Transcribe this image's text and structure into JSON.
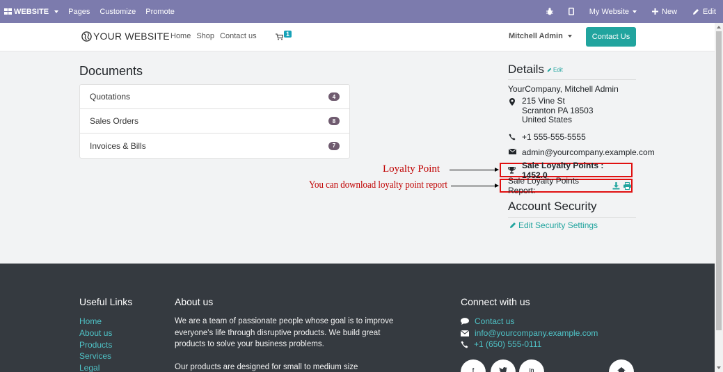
{
  "odoo_bar": {
    "apps_label": "WEBSITE",
    "menu": [
      "Pages",
      "Customize",
      "Promote"
    ],
    "website_label": "My Website",
    "new_label": "New",
    "edit_label": "Edit"
  },
  "header": {
    "logo": "YOUR WEBSITE",
    "nav": [
      "Home",
      "Shop",
      "Contact us"
    ],
    "cart_count": "1",
    "user": "Mitchell Admin",
    "contact_button": "Contact Us"
  },
  "documents": {
    "title": "Documents",
    "items": [
      {
        "label": "Quotations",
        "count": "4"
      },
      {
        "label": "Sales Orders",
        "count": "8"
      },
      {
        "label": "Invoices & Bills",
        "count": "7"
      }
    ]
  },
  "details": {
    "title": "Details",
    "edit_label": "Edit",
    "name": "YourCompany, Mitchell Admin",
    "address_lines": [
      "215 Vine St",
      "Scranton PA 18503",
      "United States"
    ],
    "phone": "+1 555-555-5555",
    "email": "admin@yourcompany.example.com",
    "loyalty_points": "Sale Loyalty Points : 1452.0",
    "report_label": "Sale Loyalty Points Report:"
  },
  "annotations": {
    "loyalty": "Loyalty Point",
    "report": "You can download loyalty point report"
  },
  "account_security": {
    "title": "Account Security",
    "link": "Edit Security Settings"
  },
  "footer": {
    "useful_links_title": "Useful Links",
    "useful_links": [
      "Home",
      "About us",
      "Products",
      "Services",
      "Legal"
    ],
    "about_title": "About us",
    "about_text_1": "We are a team of passionate people whose goal is to improve everyone's life through disruptive products. We build great products to solve your business problems.",
    "about_text_2": "Our products are designed for small to medium size",
    "connect_title": "Connect with us",
    "connect_items": [
      {
        "icon": "comment-icon",
        "text": "Contact us"
      },
      {
        "icon": "envelope-icon",
        "text": "info@yourcompany.example.com"
      },
      {
        "icon": "phone-icon",
        "text": "+1 (650) 555-0111"
      }
    ]
  },
  "colors": {
    "odoo_bar": "#7c7bad",
    "accent": "#21a49e",
    "footer": "#353a40",
    "annotation": "#c00000",
    "highlight_border": "#e01010"
  }
}
